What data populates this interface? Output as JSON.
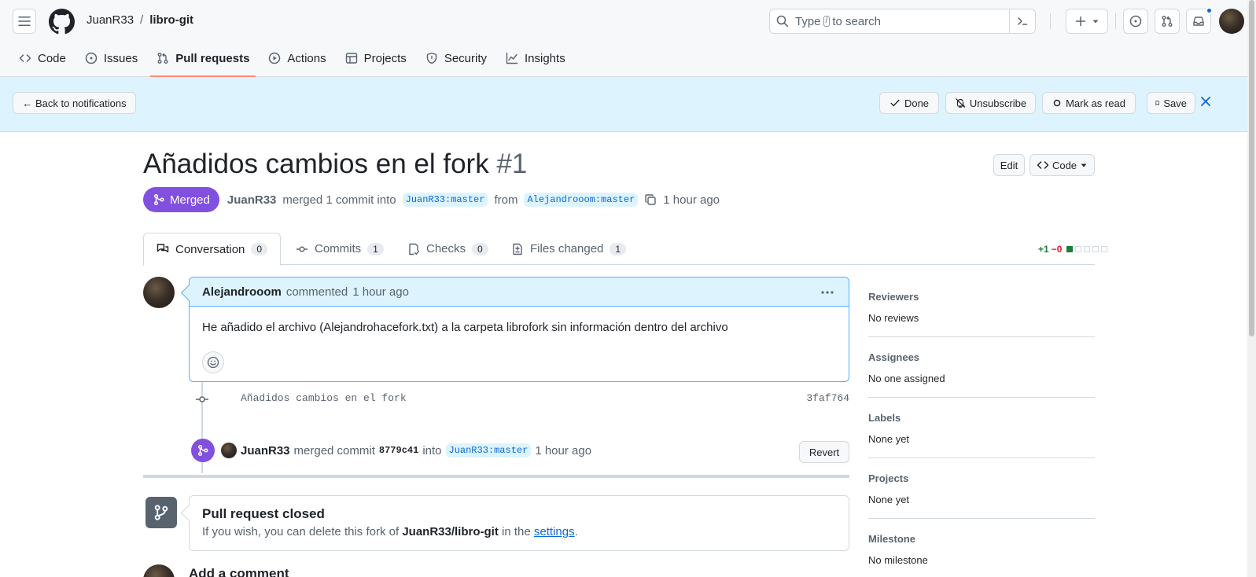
{
  "header": {
    "owner": "JuanR33",
    "separator": "/",
    "repo": "libro-git",
    "search": {
      "before": "Type",
      "key": "/",
      "after": "to search"
    }
  },
  "repo_nav": [
    {
      "label": "Code",
      "icon": "code-icon"
    },
    {
      "label": "Issues",
      "icon": "issue-icon"
    },
    {
      "label": "Pull requests",
      "icon": "pull-request-icon",
      "active": true
    },
    {
      "label": "Actions",
      "icon": "play-icon"
    },
    {
      "label": "Projects",
      "icon": "table-icon"
    },
    {
      "label": "Security",
      "icon": "shield-icon"
    },
    {
      "label": "Insights",
      "icon": "graph-icon"
    }
  ],
  "notification_bar": {
    "back": "← Back to notifications",
    "done": "Done",
    "unsubscribe": "Unsubscribe",
    "mark_read": "Mark as read",
    "save": "Save"
  },
  "pr": {
    "title": "Añadidos cambios en el fork",
    "number": "#1",
    "edit": "Edit",
    "code": "Code",
    "state": "Merged",
    "author": "JuanR33",
    "action": "merged 1 commit into",
    "base": "JuanR33:master",
    "from_word": "from",
    "head": "Alejandrooom:master",
    "time": "1 hour ago"
  },
  "tabs": [
    {
      "label": "Conversation",
      "count": "0",
      "icon": "comment-discussion-icon"
    },
    {
      "label": "Commits",
      "count": "1",
      "icon": "commit-icon"
    },
    {
      "label": "Checks",
      "count": "0",
      "icon": "checklist-icon"
    },
    {
      "label": "Files changed",
      "count": "1",
      "icon": "file-diff-icon"
    }
  ],
  "diffstat": {
    "additions": "+1",
    "deletions": "−0"
  },
  "comment": {
    "author": "Alejandrooom",
    "verb": "commented",
    "time": "1 hour ago",
    "body": "He añadido el archivo (Alejandrohacefork.txt) a la carpeta librofork sin información dentro del archivo"
  },
  "commit": {
    "message": "Añadidos cambios en el fork",
    "sha": "3faf764"
  },
  "merge_event": {
    "user": "JuanR33",
    "text": "merged commit",
    "sha": "8779c41",
    "into": "into",
    "branch": "JuanR33:master",
    "time": "1 hour ago",
    "revert": "Revert"
  },
  "closed": {
    "title": "Pull request closed",
    "prefix": "If you wish, you can delete this fork of",
    "repo": "JuanR33/libro-git",
    "middle": "in the",
    "link": "settings",
    "suffix": "."
  },
  "add_comment": "Add a comment",
  "sidebar": [
    {
      "heading": "Reviewers",
      "value": "No reviews"
    },
    {
      "heading": "Assignees",
      "value": "No one assigned"
    },
    {
      "heading": "Labels",
      "value": "None yet"
    },
    {
      "heading": "Projects",
      "value": "None yet"
    },
    {
      "heading": "Milestone",
      "value": "No milestone"
    }
  ],
  "colors": {
    "merged": "#8250df",
    "link": "#0969da",
    "notification_bg": "#ddf4ff"
  }
}
